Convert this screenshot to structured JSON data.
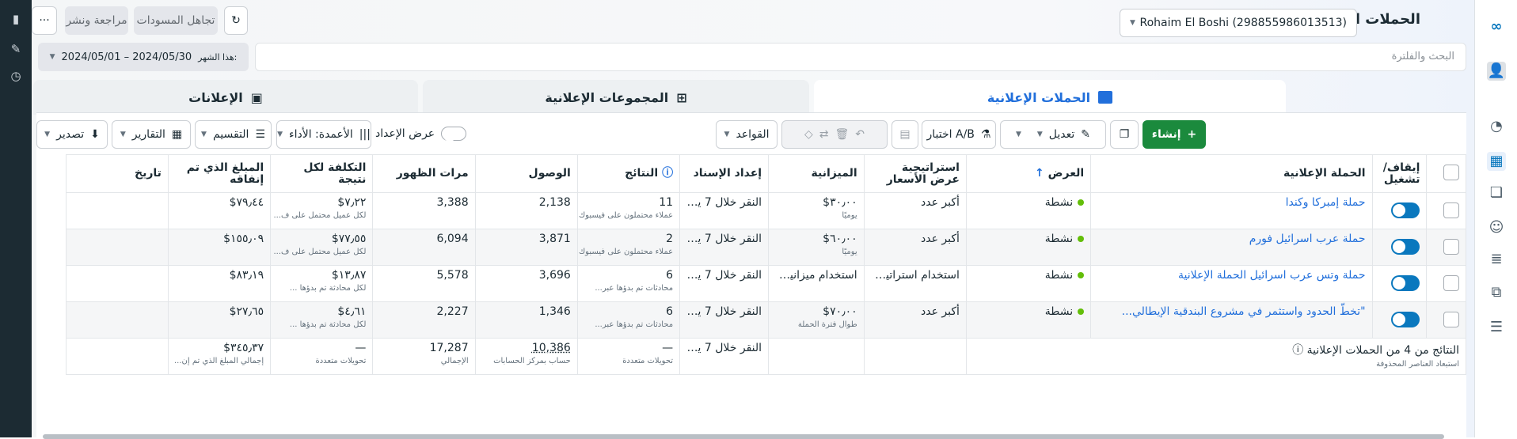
{
  "app": {
    "title": "الحملات الإعلانية",
    "account": "Rohaim El Boshi (298855986013513)"
  },
  "top_actions": {
    "refresh": "↻",
    "discard": "تجاهل المسودات",
    "review": "مراجعة ونشر",
    "more": "···"
  },
  "search": {
    "placeholder": "البحث والفلترة"
  },
  "date_range": {
    "prefix": "هذا الشهر:",
    "range": "2024/05/01 – 2024/05/30"
  },
  "tabs": {
    "campaigns": "الحملات الإعلانية",
    "adsets": "المجموعات الإعلانية",
    "ads": "الإعلانات"
  },
  "toolbar": {
    "create": "إنشاء",
    "edit": "تعديل",
    "ab_test": "اختبار A/B",
    "rules": "القواعد",
    "setup_view": "عرض الإعداد",
    "columns": "الأعمدة: الأداء",
    "breakdown": "التقسيم",
    "reports": "التقارير",
    "export": "تصدير"
  },
  "columns": [
    "إيقاف/تشغيل",
    "الحملة الإعلانية",
    "العرض",
    "استراتيجية عرض الأسعار",
    "الميزانية",
    "إعداد الإسناد",
    "النتائج",
    "الوصول",
    "مرات الظهور",
    "التكلفة لكل نتيجة",
    "المبلغ الذي تم إنفاقه",
    "تاريخ"
  ],
  "rows": [
    {
      "name": "حملة إمبركا وكندا",
      "delivery": "نشطة",
      "bid": "أكبر عدد",
      "budget": "٣٠٫٠٠$",
      "budget_sub": "يوميًا",
      "attr": "النقر خلال 7 يوم...",
      "results": "11",
      "results_sub": "عملاء محتملون على فيسبوك",
      "reach": "2,138",
      "impressions": "3,388",
      "cpr": "٧٫٢٢$",
      "cpr_sub": "لكل عميل محتمل على ف...",
      "spent": "٧٩٫٤٤$"
    },
    {
      "name": "حملة عرب اسرائيل فورم",
      "delivery": "نشطة",
      "bid": "أكبر عدد",
      "budget": "٦٠٫٠٠$",
      "budget_sub": "يوميًا",
      "attr": "النقر خلال 7 يوم...",
      "results": "2",
      "results_sub": "عملاء محتملون على فيسبوك",
      "reach": "3,871",
      "impressions": "6,094",
      "cpr": "٧٧٫٥٥$",
      "cpr_sub": "لكل عميل محتمل على ف...",
      "spent": "١٥٥٫٠٩$"
    },
    {
      "name": "حملة وتس عرب اسرائيل الحملة الإعلانية",
      "delivery": "نشطة",
      "bid": "استخدام استراتيجي...",
      "budget": "استخدام ميزانية ال...",
      "budget_sub": "",
      "attr": "النقر خلال 7 يوم...",
      "results": "6",
      "results_sub": "محادثات تم بدؤها عبر...",
      "reach": "3,696",
      "impressions": "5,578",
      "cpr": "١٣٫٨٧$",
      "cpr_sub": "لكل محادثة تم بدؤها ...",
      "spent": "٨٣٫١٩$"
    },
    {
      "name": "\"تخطّ الحدود واستثمر في مشروع البندقية الإيطالي...",
      "delivery": "نشطة",
      "bid": "أكبر عدد",
      "budget": "٧٠٫٠٠$",
      "budget_sub": "طوال فترة الحملة",
      "attr": "النقر خلال 7 يوم...",
      "results": "6",
      "results_sub": "محادثات تم بدؤها عبر...",
      "reach": "1,346",
      "impressions": "2,227",
      "cpr": "٤٫٦١$",
      "cpr_sub": "لكل محادثة تم بدؤها ...",
      "spent": "٢٧٫٦٥$"
    }
  ],
  "summary": {
    "label": "النتائج من 4 من الحملات الإعلانية",
    "sub": "استبعاد العناصر المحذوفة",
    "attr": "النقر خلال 7 يوم...",
    "results": "—",
    "results_sub": "تحويلات متعددة",
    "reach": "10,386",
    "reach_sub": "حساب بمركز الحسابات",
    "impressions": "17,287",
    "impressions_sub": "الإجمالي",
    "cpr": "—",
    "cpr_sub": "تحويلات متعددة",
    "spent": "٣٤٥٫٣٧$",
    "spent_sub": "إجمالي المبلغ الذي تم إن..."
  },
  "colors": {
    "accent": "#0a78be",
    "green": "#1b8a3d",
    "link": "#216fdb"
  }
}
